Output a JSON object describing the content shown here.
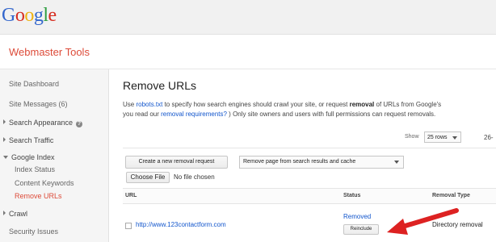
{
  "header": {
    "logo": {
      "g1": "G",
      "o1": "o",
      "o2": "o",
      "g2": "g",
      "l": "l",
      "e": "e"
    },
    "product_title": "Webmaster Tools"
  },
  "sidebar": {
    "items": [
      {
        "label": "Site Dashboard"
      },
      {
        "label": "Site Messages (6)"
      },
      {
        "label": "Search Appearance"
      },
      {
        "label": "Search Traffic"
      },
      {
        "label": "Google Index"
      },
      {
        "label": "Index Status"
      },
      {
        "label": "Content Keywords"
      },
      {
        "label": "Remove URLs"
      },
      {
        "label": "Crawl"
      },
      {
        "label": "Security Issues"
      }
    ]
  },
  "main": {
    "title": "Remove URLs",
    "desc": {
      "t1": "Use ",
      "robots_link": "robots.txt",
      "t2": " to specify how search engines should crawl your site, or request ",
      "removal_bold": "removal",
      "t3": " of URLs from Google's",
      "t4": "you read our ",
      "req_link": "removal requirements?",
      "t5": " )  Only site owners and users with full permissions can request removals."
    },
    "show_label": "Show",
    "rows_value": "25 rows",
    "pager_text": "26-",
    "new_request_button": "Create a new removal request",
    "reason_select": "Remove page from search results and cache",
    "choose_file_button": "Choose File",
    "no_file_text": "No file chosen",
    "table": {
      "headers": {
        "url": "URL",
        "status": "Status",
        "type": "Removal Type"
      },
      "rows": [
        {
          "url": "http://www.123contactform.com",
          "status": "Removed",
          "action": "Reinclude",
          "type": "Directory removal"
        }
      ]
    }
  },
  "colors": {
    "accent": "#dd4b39",
    "link": "#1155cc",
    "arrow": "#dd2222"
  }
}
